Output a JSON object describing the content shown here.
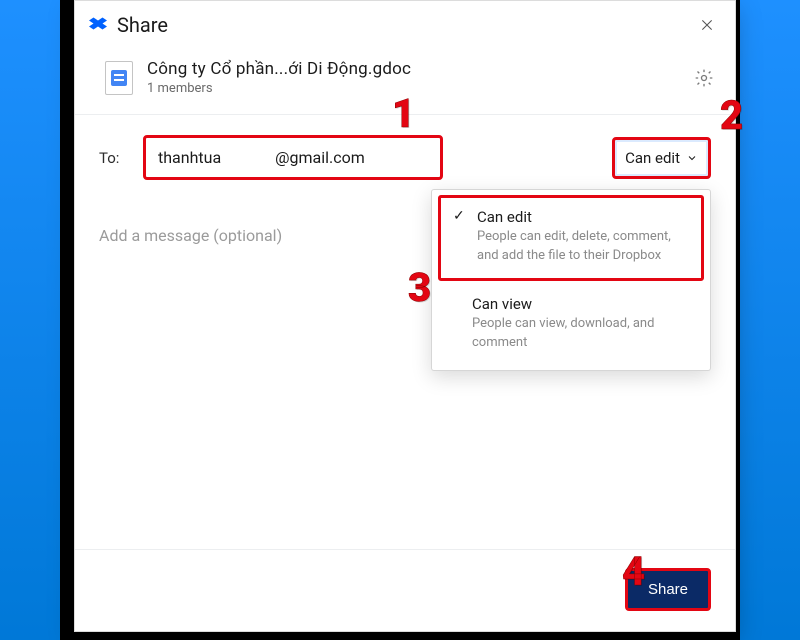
{
  "title": "Share",
  "file": {
    "name": "Công ty Cổ phần...ới Di Động.gdoc",
    "members": "1 members"
  },
  "to_label": "To:",
  "email": {
    "prefix": "thanhtua",
    "suffix": "@gmail.com"
  },
  "permission": {
    "selected_label": "Can edit",
    "options": [
      {
        "label": "Can edit",
        "description": "People can edit, delete, comment, and add the file to their Dropbox",
        "selected": true
      },
      {
        "label": "Can view",
        "description": "People can view, download, and comment",
        "selected": false
      }
    ]
  },
  "message_placeholder": "Add a message (optional)",
  "buttons": {
    "share": "Share"
  },
  "callouts": {
    "one": "1",
    "two": "2",
    "three": "3",
    "four": "4"
  }
}
